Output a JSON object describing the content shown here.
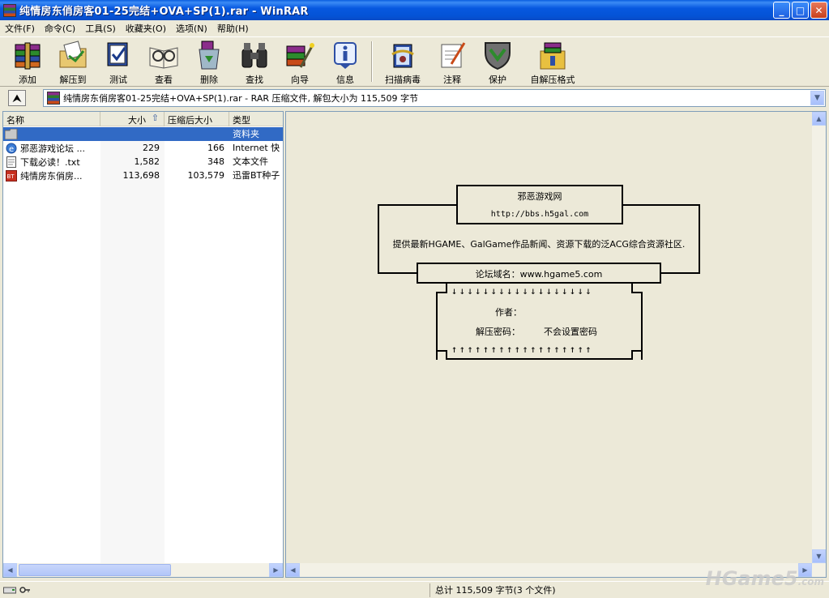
{
  "window": {
    "title": "纯情房东俏房客01-25完结+OVA+SP(1).rar - WinRAR",
    "minimize": "_",
    "maximize": "□",
    "close": "✕"
  },
  "menu": [
    "文件(F)",
    "命令(C)",
    "工具(S)",
    "收藏夹(O)",
    "选项(N)",
    "帮助(H)"
  ],
  "toolbar": {
    "add": "添加",
    "extract": "解压到",
    "test": "测试",
    "view": "查看",
    "delete": "删除",
    "find": "查找",
    "wizard": "向导",
    "info": "信息",
    "virus_scan": "扫描病毒",
    "comment": "注释",
    "protect": "保护",
    "sfx": "自解压格式"
  },
  "address": {
    "up": "⮝",
    "text": "纯情房东俏房客01-25完结+OVA+SP(1).rar - RAR 压缩文件, 解包大小为 115,509 字节"
  },
  "list": {
    "columns": {
      "name": "名称",
      "size": "大小",
      "packed": "压缩后大小",
      "type": "类型"
    },
    "rows": [
      {
        "name": "",
        "size": "",
        "packed": "",
        "type": "资料夹"
      },
      {
        "name": "邪恶游戏论坛 ...",
        "size": "229",
        "packed": "166",
        "type": "Internet 快"
      },
      {
        "name": "下载必读！.txt",
        "size": "1,582",
        "packed": "348",
        "type": "文本文件"
      },
      {
        "name": "纯情房东俏房...",
        "size": "113,698",
        "packed": "103,579",
        "type": "迅雷BT种子"
      }
    ]
  },
  "comment": {
    "site_name": "邪恶游戏网",
    "site_url": "http://bbs.h5gal.com",
    "description": "提供最新HGAME、GalGame作品新闻、资源下载的泛ACG综合资源社区.",
    "forum_domain": "论坛域名：www.hgame5.com",
    "arrows_down": "↓↓↓↓↓↓↓↓↓↓↓↓↓↓↓↓↓↓",
    "author_label": "作者：",
    "password_label": "解压密码：",
    "password_value": "不会设置密码",
    "arrows_up": "↑↑↑↑↑↑↑↑↑↑↑↑↑↑↑↑↑↑"
  },
  "status": {
    "summary": "总计 115,509 字节(3 个文件)"
  },
  "watermark": {
    "main": "HGame5",
    "suffix": ".com"
  }
}
